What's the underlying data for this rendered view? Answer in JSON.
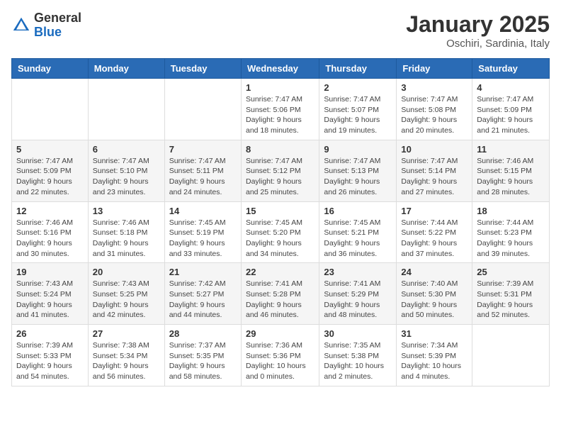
{
  "logo": {
    "general": "General",
    "blue": "Blue"
  },
  "title": "January 2025",
  "location": "Oschiri, Sardinia, Italy",
  "weekdays": [
    "Sunday",
    "Monday",
    "Tuesday",
    "Wednesday",
    "Thursday",
    "Friday",
    "Saturday"
  ],
  "weeks": [
    [
      {
        "day": "",
        "info": ""
      },
      {
        "day": "",
        "info": ""
      },
      {
        "day": "",
        "info": ""
      },
      {
        "day": "1",
        "info": "Sunrise: 7:47 AM\nSunset: 5:06 PM\nDaylight: 9 hours and 18 minutes."
      },
      {
        "day": "2",
        "info": "Sunrise: 7:47 AM\nSunset: 5:07 PM\nDaylight: 9 hours and 19 minutes."
      },
      {
        "day": "3",
        "info": "Sunrise: 7:47 AM\nSunset: 5:08 PM\nDaylight: 9 hours and 20 minutes."
      },
      {
        "day": "4",
        "info": "Sunrise: 7:47 AM\nSunset: 5:09 PM\nDaylight: 9 hours and 21 minutes."
      }
    ],
    [
      {
        "day": "5",
        "info": "Sunrise: 7:47 AM\nSunset: 5:09 PM\nDaylight: 9 hours and 22 minutes."
      },
      {
        "day": "6",
        "info": "Sunrise: 7:47 AM\nSunset: 5:10 PM\nDaylight: 9 hours and 23 minutes."
      },
      {
        "day": "7",
        "info": "Sunrise: 7:47 AM\nSunset: 5:11 PM\nDaylight: 9 hours and 24 minutes."
      },
      {
        "day": "8",
        "info": "Sunrise: 7:47 AM\nSunset: 5:12 PM\nDaylight: 9 hours and 25 minutes."
      },
      {
        "day": "9",
        "info": "Sunrise: 7:47 AM\nSunset: 5:13 PM\nDaylight: 9 hours and 26 minutes."
      },
      {
        "day": "10",
        "info": "Sunrise: 7:47 AM\nSunset: 5:14 PM\nDaylight: 9 hours and 27 minutes."
      },
      {
        "day": "11",
        "info": "Sunrise: 7:46 AM\nSunset: 5:15 PM\nDaylight: 9 hours and 28 minutes."
      }
    ],
    [
      {
        "day": "12",
        "info": "Sunrise: 7:46 AM\nSunset: 5:16 PM\nDaylight: 9 hours and 30 minutes."
      },
      {
        "day": "13",
        "info": "Sunrise: 7:46 AM\nSunset: 5:18 PM\nDaylight: 9 hours and 31 minutes."
      },
      {
        "day": "14",
        "info": "Sunrise: 7:45 AM\nSunset: 5:19 PM\nDaylight: 9 hours and 33 minutes."
      },
      {
        "day": "15",
        "info": "Sunrise: 7:45 AM\nSunset: 5:20 PM\nDaylight: 9 hours and 34 minutes."
      },
      {
        "day": "16",
        "info": "Sunrise: 7:45 AM\nSunset: 5:21 PM\nDaylight: 9 hours and 36 minutes."
      },
      {
        "day": "17",
        "info": "Sunrise: 7:44 AM\nSunset: 5:22 PM\nDaylight: 9 hours and 37 minutes."
      },
      {
        "day": "18",
        "info": "Sunrise: 7:44 AM\nSunset: 5:23 PM\nDaylight: 9 hours and 39 minutes."
      }
    ],
    [
      {
        "day": "19",
        "info": "Sunrise: 7:43 AM\nSunset: 5:24 PM\nDaylight: 9 hours and 41 minutes."
      },
      {
        "day": "20",
        "info": "Sunrise: 7:43 AM\nSunset: 5:25 PM\nDaylight: 9 hours and 42 minutes."
      },
      {
        "day": "21",
        "info": "Sunrise: 7:42 AM\nSunset: 5:27 PM\nDaylight: 9 hours and 44 minutes."
      },
      {
        "day": "22",
        "info": "Sunrise: 7:41 AM\nSunset: 5:28 PM\nDaylight: 9 hours and 46 minutes."
      },
      {
        "day": "23",
        "info": "Sunrise: 7:41 AM\nSunset: 5:29 PM\nDaylight: 9 hours and 48 minutes."
      },
      {
        "day": "24",
        "info": "Sunrise: 7:40 AM\nSunset: 5:30 PM\nDaylight: 9 hours and 50 minutes."
      },
      {
        "day": "25",
        "info": "Sunrise: 7:39 AM\nSunset: 5:31 PM\nDaylight: 9 hours and 52 minutes."
      }
    ],
    [
      {
        "day": "26",
        "info": "Sunrise: 7:39 AM\nSunset: 5:33 PM\nDaylight: 9 hours and 54 minutes."
      },
      {
        "day": "27",
        "info": "Sunrise: 7:38 AM\nSunset: 5:34 PM\nDaylight: 9 hours and 56 minutes."
      },
      {
        "day": "28",
        "info": "Sunrise: 7:37 AM\nSunset: 5:35 PM\nDaylight: 9 hours and 58 minutes."
      },
      {
        "day": "29",
        "info": "Sunrise: 7:36 AM\nSunset: 5:36 PM\nDaylight: 10 hours and 0 minutes."
      },
      {
        "day": "30",
        "info": "Sunrise: 7:35 AM\nSunset: 5:38 PM\nDaylight: 10 hours and 2 minutes."
      },
      {
        "day": "31",
        "info": "Sunrise: 7:34 AM\nSunset: 5:39 PM\nDaylight: 10 hours and 4 minutes."
      },
      {
        "day": "",
        "info": ""
      }
    ]
  ]
}
